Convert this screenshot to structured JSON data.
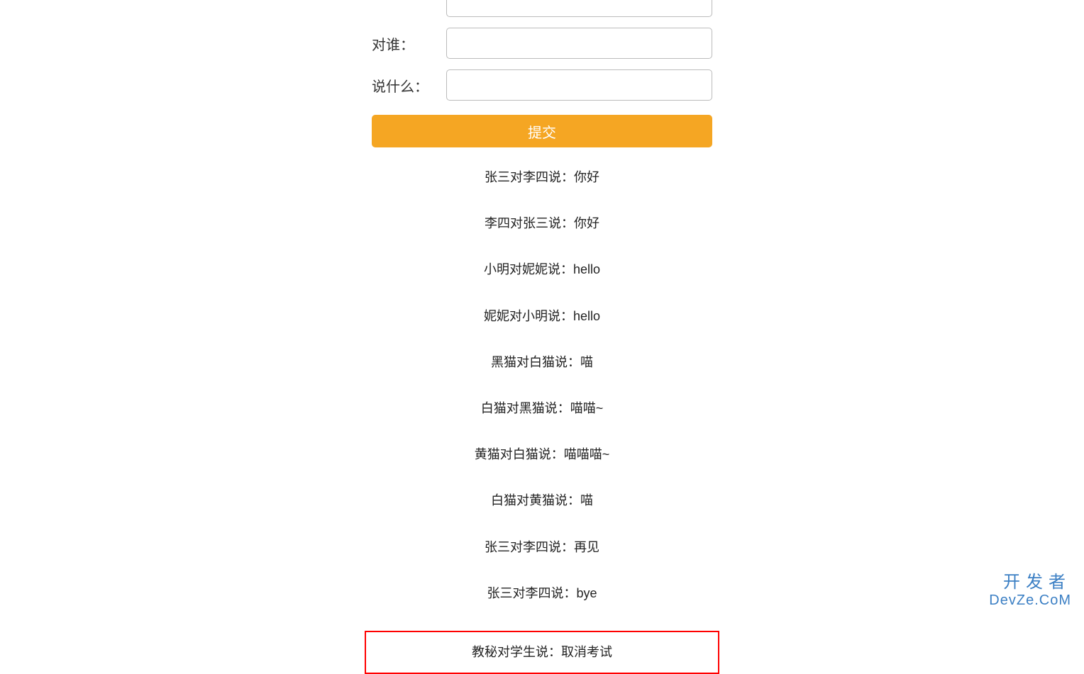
{
  "form": {
    "input_partial_value": "",
    "to_label": "对谁：",
    "to_value": "",
    "say_label": "说什么：",
    "say_value": "",
    "submit_label": "提交"
  },
  "messages": [
    {
      "text": "张三对李四说：你好",
      "highlighted": false
    },
    {
      "text": "李四对张三说：你好",
      "highlighted": false
    },
    {
      "text": "小明对妮妮说：hello",
      "highlighted": false
    },
    {
      "text": "妮妮对小明说：hello",
      "highlighted": false
    },
    {
      "text": "黑猫对白猫说：喵",
      "highlighted": false
    },
    {
      "text": "白猫对黑猫说：喵喵~",
      "highlighted": false
    },
    {
      "text": "黄猫对白猫说：喵喵喵~",
      "highlighted": false
    },
    {
      "text": "白猫对黄猫说：喵",
      "highlighted": false
    },
    {
      "text": "张三对李四说：再见",
      "highlighted": false
    },
    {
      "text": "张三对李四说：bye",
      "highlighted": false
    },
    {
      "text": "教秘对学生说：取消考试",
      "highlighted": true
    }
  ],
  "watermark": {
    "line1": "开发者",
    "line2": "DevZe.CoM"
  }
}
